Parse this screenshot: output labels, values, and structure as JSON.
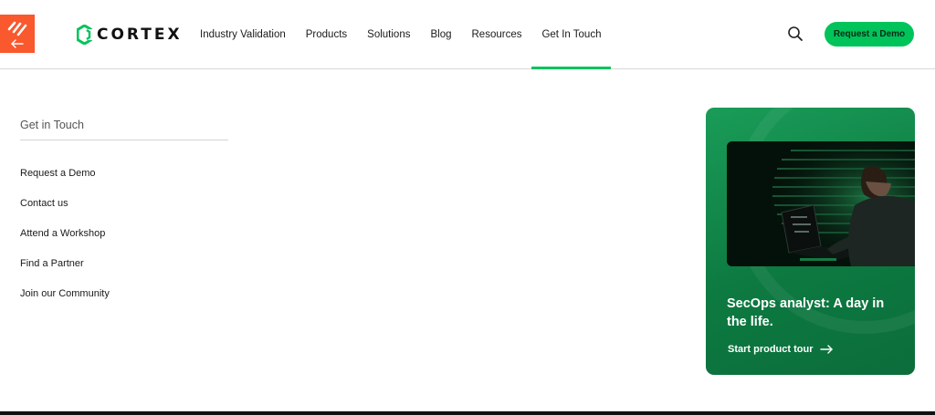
{
  "colors": {
    "accent": "#00c35a",
    "brand_badge": "#fa582d",
    "promo_bg": "#0d7a41"
  },
  "header": {
    "logo_text": "CORTEX",
    "nav": [
      {
        "label": "Industry Validation",
        "active": false
      },
      {
        "label": "Products",
        "active": false
      },
      {
        "label": "Solutions",
        "active": false
      },
      {
        "label": "Blog",
        "active": false
      },
      {
        "label": "Resources",
        "active": false
      },
      {
        "label": "Get In Touch",
        "active": true
      }
    ],
    "search_icon": "search-icon",
    "cta_label": "Request a Demo"
  },
  "side_menu": {
    "title": "Get in Touch",
    "items": [
      {
        "label": "Request a Demo"
      },
      {
        "label": "Contact us"
      },
      {
        "label": "Attend a Workshop"
      },
      {
        "label": "Find a Partner"
      },
      {
        "label": "Join our Community"
      }
    ]
  },
  "promo": {
    "title": "SecOps analyst: A day in the life.",
    "cta_label": "Start product tour",
    "cta_icon": "arrow-right-icon"
  }
}
